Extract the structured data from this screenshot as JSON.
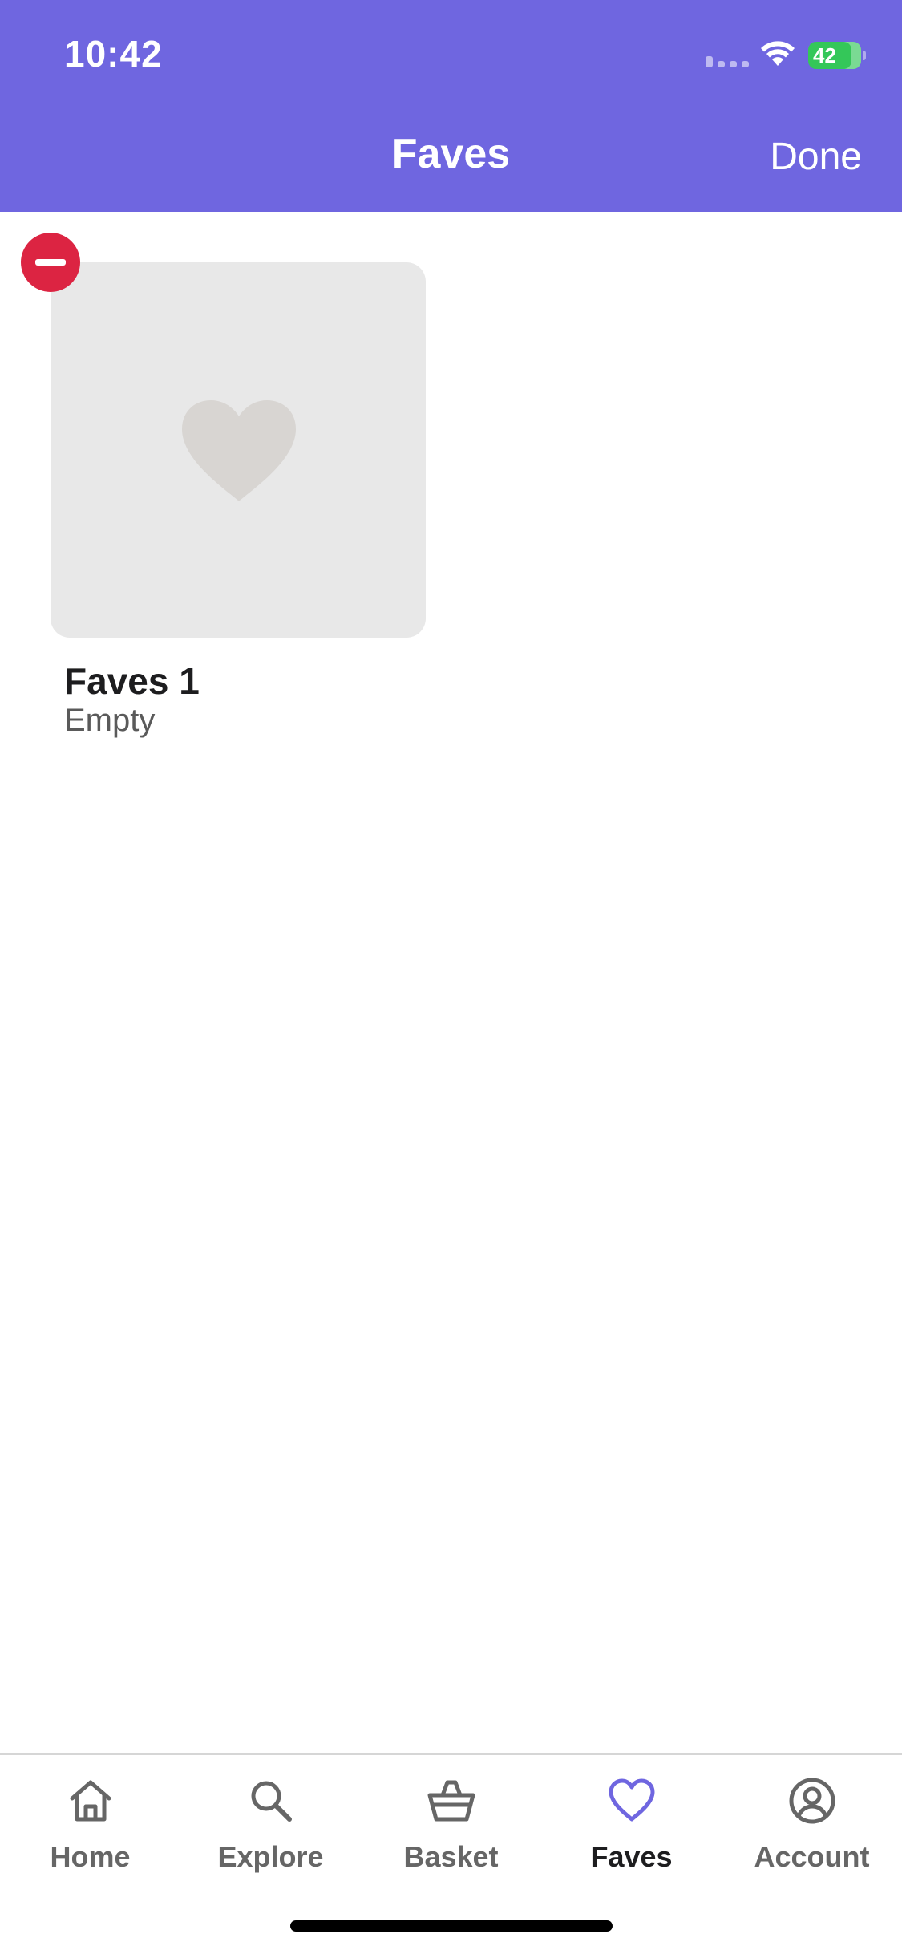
{
  "status_bar": {
    "time": "10:42",
    "battery": "42"
  },
  "header": {
    "title": "Faves",
    "done_label": "Done"
  },
  "faves_list": [
    {
      "name": "Faves 1",
      "status": "Empty"
    }
  ],
  "tab_bar": {
    "items": [
      {
        "label": "Home",
        "icon": "home-icon",
        "active": false
      },
      {
        "label": "Explore",
        "icon": "search-icon",
        "active": false
      },
      {
        "label": "Basket",
        "icon": "basket-icon",
        "active": false
      },
      {
        "label": "Faves",
        "icon": "heart-icon",
        "active": true
      },
      {
        "label": "Account",
        "icon": "account-icon",
        "active": false
      }
    ]
  },
  "colors": {
    "header": "#6f66e0",
    "accent": "#6f66e0",
    "remove": "#dc2442",
    "card": "#e8e8e8",
    "heart_placeholder": "#d8d5d2"
  }
}
